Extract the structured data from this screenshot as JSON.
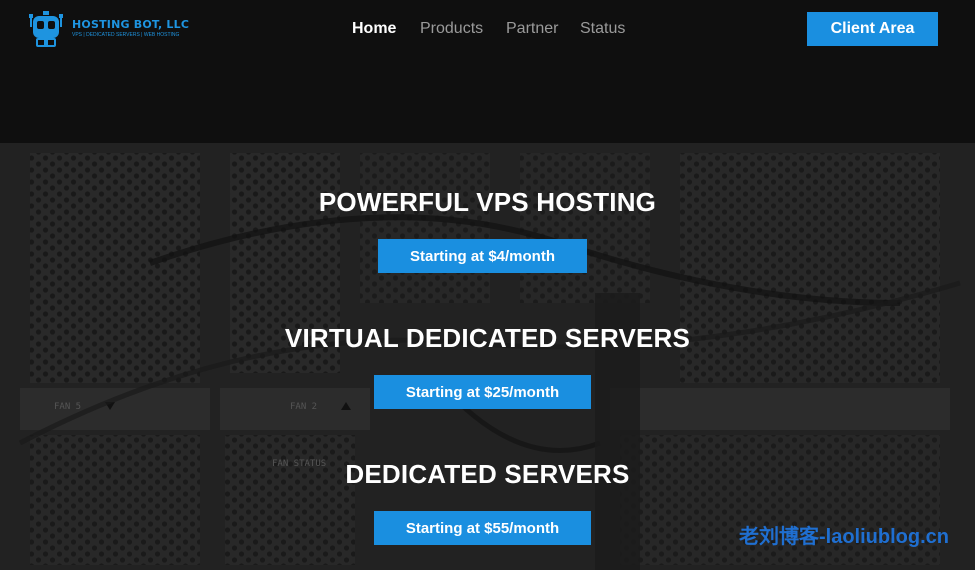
{
  "brand": {
    "name": "HOSTING BOT, LLC",
    "tagline": "VPS | DEDICATED SERVERS | WEB HOSTING",
    "accent": "#1a8fe0"
  },
  "nav": {
    "items": [
      {
        "label": "Home",
        "active": true
      },
      {
        "label": "Products",
        "active": false
      },
      {
        "label": "Partner",
        "active": false
      },
      {
        "label": "Status",
        "active": false
      }
    ],
    "client_area_label": "Client Area"
  },
  "hero": {
    "background_panel_labels": [
      "FAN 5",
      "FAN 2",
      "FAN STATUS"
    ],
    "offers": [
      {
        "title": "POWERFUL VPS HOSTING",
        "button": "Starting at $4/month"
      },
      {
        "title": "VIRTUAL DEDICATED SERVERS",
        "button": "Starting at $25/month"
      },
      {
        "title": "DEDICATED SERVERS",
        "button": "Starting at $55/month"
      }
    ]
  },
  "watermark": "老刘博客-laoliublog.cn"
}
